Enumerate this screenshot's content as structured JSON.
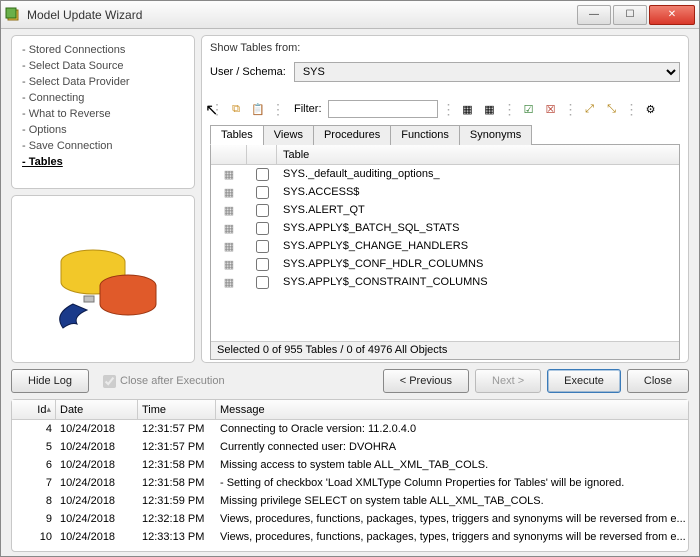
{
  "window": {
    "title": "Model Update Wizard"
  },
  "steps": [
    "Stored Connections",
    "Select Data Source",
    "Select Data Provider",
    "Connecting",
    "What to Reverse",
    "Options",
    "Save Connection",
    "Tables"
  ],
  "currentStep": 7,
  "right": {
    "showFrom": "Show Tables from:",
    "schemaLabel": "User / Schema:",
    "schemaValue": "SYS",
    "filterLabel": "Filter:",
    "filterValue": ""
  },
  "tabs": [
    "Tables",
    "Views",
    "Procedures",
    "Functions",
    "Synonyms"
  ],
  "activeTab": 0,
  "gridHeader": "Table",
  "rows": [
    "SYS._default_auditing_options_",
    "SYS.ACCESS$",
    "SYS.ALERT_QT",
    "SYS.APPLY$_BATCH_SQL_STATS",
    "SYS.APPLY$_CHANGE_HANDLERS",
    "SYS.APPLY$_CONF_HDLR_COLUMNS",
    "SYS.APPLY$_CONSTRAINT_COLUMNS"
  ],
  "status": "Selected 0 of 955 Tables / 0 of 4976 All Objects",
  "buttons": {
    "hideLog": "Hide Log",
    "closeAfter": "Close after Execution",
    "prev": "< Previous",
    "next": "Next >",
    "execute": "Execute",
    "close": "Close"
  },
  "logHeaders": {
    "id": "Id",
    "date": "Date",
    "time": "Time",
    "msg": "Message"
  },
  "log": [
    {
      "id": 4,
      "date": "10/24/2018",
      "time": "12:31:57 PM",
      "msg": "Connecting to Oracle version: 11.2.0.4.0"
    },
    {
      "id": 5,
      "date": "10/24/2018",
      "time": "12:31:57 PM",
      "msg": "Currently connected user: DVOHRA"
    },
    {
      "id": 6,
      "date": "10/24/2018",
      "time": "12:31:58 PM",
      "msg": "Missing access to system table ALL_XML_TAB_COLS."
    },
    {
      "id": 7,
      "date": "10/24/2018",
      "time": "12:31:58 PM",
      "msg": "  - Setting of checkbox 'Load XMLType Column Properties for Tables' will be ignored."
    },
    {
      "id": 8,
      "date": "10/24/2018",
      "time": "12:31:59 PM",
      "msg": "Missing privilege SELECT on system table ALL_XML_TAB_COLS."
    },
    {
      "id": 9,
      "date": "10/24/2018",
      "time": "12:32:18 PM",
      "msg": "Views, procedures, functions, packages, types, triggers and synonyms will be reversed from e..."
    },
    {
      "id": 10,
      "date": "10/24/2018",
      "time": "12:33:13 PM",
      "msg": "Views, procedures, functions, packages, types, triggers and synonyms will be reversed from e..."
    }
  ]
}
